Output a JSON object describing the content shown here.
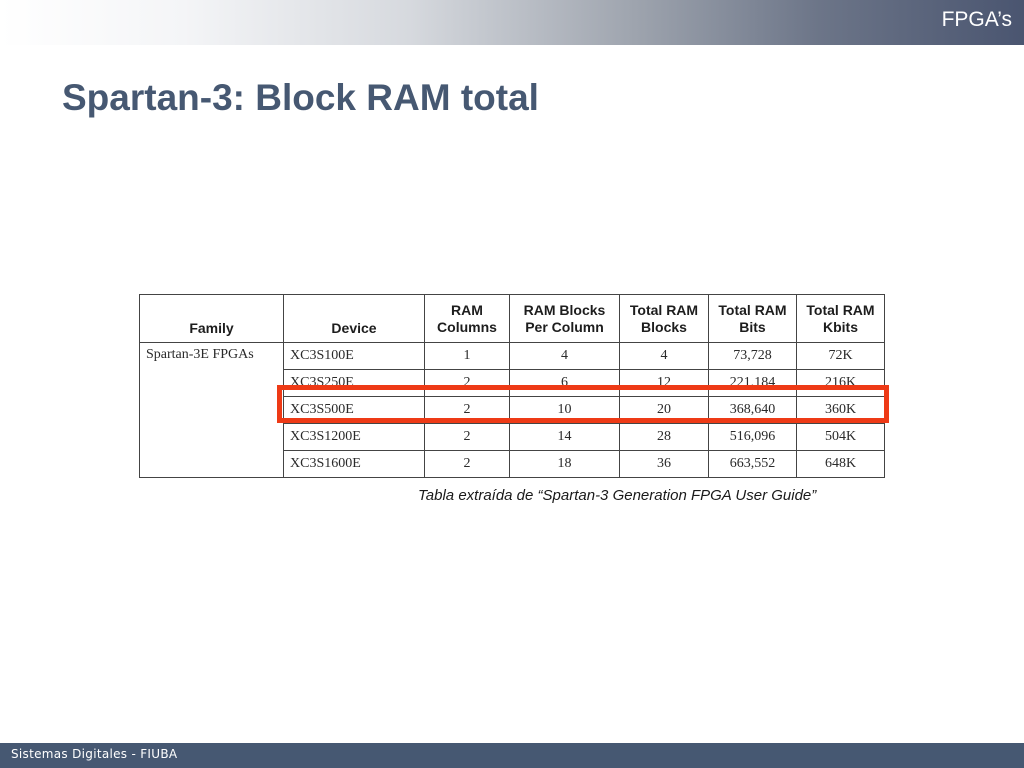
{
  "header": {
    "section_label": "FPGA’s"
  },
  "title": "Spartan-3: Block RAM total",
  "table": {
    "columns": [
      {
        "label_line1": "Family",
        "label_line2": ""
      },
      {
        "label_line1": "Device",
        "label_line2": ""
      },
      {
        "label_line1": "RAM",
        "label_line2": "Columns"
      },
      {
        "label_line1": "RAM Blocks",
        "label_line2": "Per Column"
      },
      {
        "label_line1": "Total RAM",
        "label_line2": "Blocks"
      },
      {
        "label_line1": "Total RAM",
        "label_line2": "Bits"
      },
      {
        "label_line1": "Total RAM",
        "label_line2": "Kbits"
      }
    ],
    "family": "Spartan-3E FPGAs",
    "rows": [
      [
        "XC3S100E",
        "1",
        "4",
        "4",
        "73,728",
        "72K"
      ],
      [
        "XC3S250E",
        "2",
        "6",
        "12",
        "221,184",
        "216K"
      ],
      [
        "XC3S500E",
        "2",
        "10",
        "20",
        "368,640",
        "360K"
      ],
      [
        "XC3S1200E",
        "2",
        "14",
        "28",
        "516,096",
        "504K"
      ],
      [
        "XC3S1600E",
        "2",
        "18",
        "36",
        "663,552",
        "648K"
      ]
    ],
    "highlight_color": "#ee3a16"
  },
  "caption": "Tabla extraída de “Spartan-3 Generation FPGA User Guide”",
  "footer": {
    "text": "Sistemas Digitales - FIUBA"
  },
  "colors": {
    "title": "#465872",
    "footer_bar": "#465872"
  }
}
